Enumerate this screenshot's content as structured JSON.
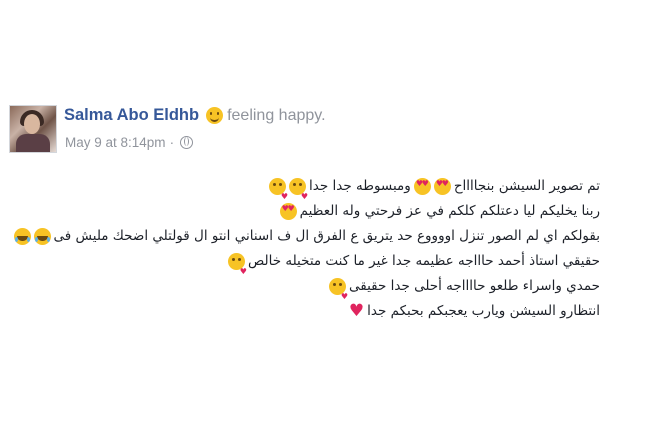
{
  "post": {
    "author": "Salma Abo Eldhb",
    "feeling": "feeling happy.",
    "timestamp": "May 9 at 8:14pm",
    "separator": "·",
    "lines": [
      "تم تصوير السيشن بنجااااح",
      "ومبسوطه جدا جدا",
      "ربنا يخليكم ليا دعتلكم كلكم في عز فرحتي وله العظيم",
      "بقولكم اي لم الصور تنزل اووووع حد يتريق ع الفرق ال ف اسناني انتو ال قولتلي اضحك مليش فى",
      "حقيقي استاذ أحمد حاااجه عظيمه جدا غير ما كنت متخيله خالص",
      "حمدي واسراء طلعو حااااجه أحلى جدا حقيقى",
      "انتظارو السيشن ويارب يعجبكم بحبكم جدا"
    ],
    "icons": {
      "feeling": "smile-icon",
      "privacy": "globe-icon",
      "line1": [
        "kiss-emoji-icon",
        "kiss-emoji-icon",
        "heart-eyes-emoji-icon",
        "heart-eyes-emoji-icon"
      ],
      "line2": [
        "heart-eyes-emoji-icon"
      ],
      "line3": [
        "laughing-emoji-icon",
        "laughing-emoji-icon"
      ],
      "line4": [
        "kiss-emoji-icon"
      ],
      "line5": [
        "kiss-emoji-icon"
      ],
      "line6": [
        "heart-icon"
      ]
    }
  }
}
